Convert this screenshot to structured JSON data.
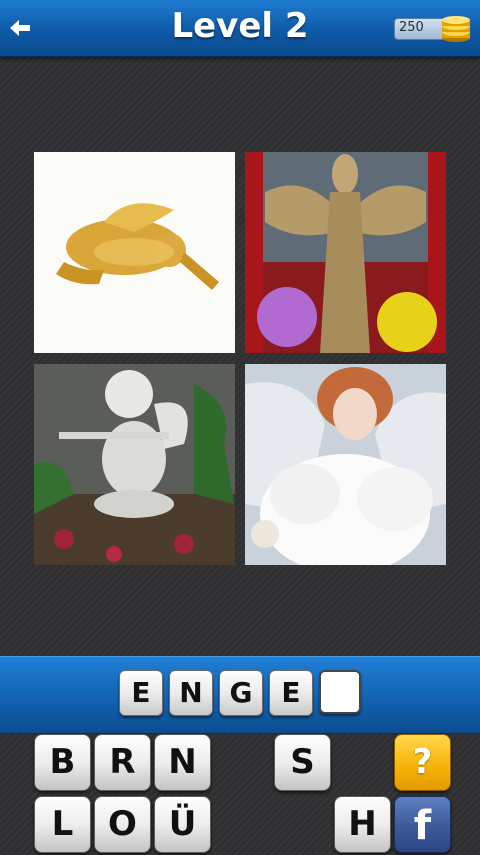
{
  "header": {
    "title": "Level 2",
    "back_icon": "arrow-left-icon",
    "coins": "250",
    "coin_icon": "coin-stack-icon"
  },
  "photos": [
    {
      "description_icon": "photo-golden-angel-ornament"
    },
    {
      "description_icon": "photo-straw-angel-statue"
    },
    {
      "description_icon": "photo-stone-cherub-flute"
    },
    {
      "description_icon": "photo-porcelain-angel-doll"
    }
  ],
  "answer": {
    "letters": [
      "E",
      "N",
      "G",
      "E",
      ""
    ]
  },
  "keyboard": {
    "row1": [
      "B",
      "R",
      "N",
      "S"
    ],
    "row2": [
      "L",
      "O",
      "Ü",
      "H"
    ],
    "hint_label": "?",
    "facebook_label": "f"
  },
  "colors": {
    "header_blue": "#1262b2",
    "hint_yellow": "#f7b50a",
    "facebook_blue": "#3b5998"
  }
}
